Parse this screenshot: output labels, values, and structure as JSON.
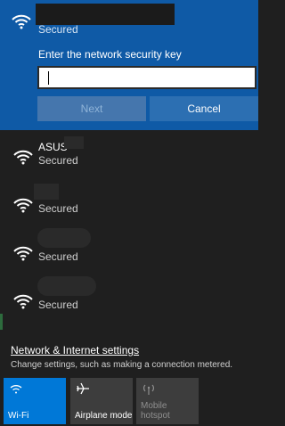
{
  "selected_network": {
    "status": "Secured",
    "prompt": "Enter the network security key",
    "key_placeholder": "",
    "next_label": "Next",
    "cancel_label": "Cancel"
  },
  "networks": [
    {
      "name": "ASUS",
      "status": "Secured"
    },
    {
      "name": "",
      "status": "Secured"
    },
    {
      "name": "",
      "status": "Secured"
    },
    {
      "name": "",
      "status": "Secured"
    }
  ],
  "settings": {
    "link": "Network & Internet settings",
    "hint": "Change settings, such as making a connection metered."
  },
  "quick_actions": {
    "wifi": {
      "label": "Wi-Fi",
      "icon": "wifi-icon"
    },
    "airplane": {
      "label": "Airplane mode",
      "icon": "airplane-icon"
    },
    "hotspot": {
      "label_line1": "Mobile",
      "label_line2": "hotspot",
      "icon": "hotspot-icon"
    }
  },
  "colors": {
    "accent": "#0078d7",
    "selected_bg": "#0f5aa6",
    "panel_bg": "#1f1f1f"
  }
}
